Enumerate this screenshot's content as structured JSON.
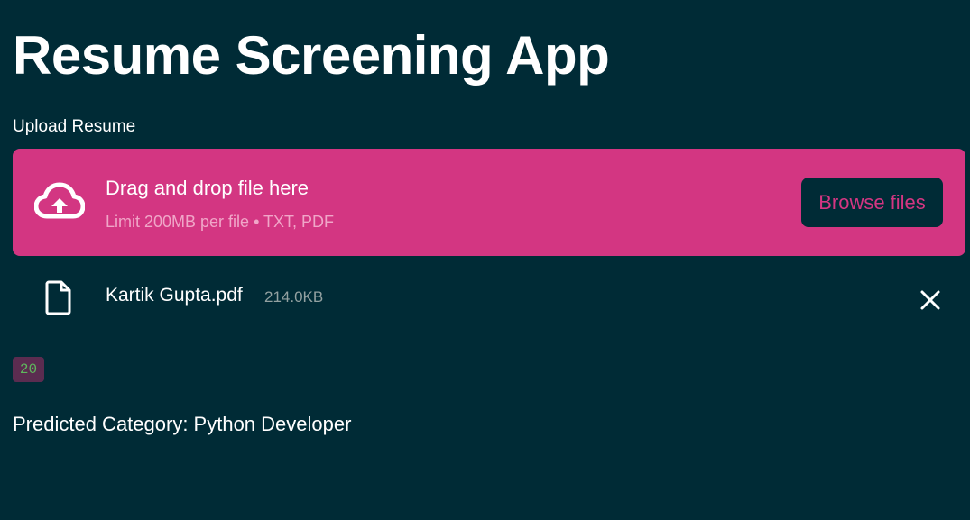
{
  "app": {
    "title": "Resume Screening App"
  },
  "uploader": {
    "label": "Upload Resume",
    "drop_title": "Drag and drop file here",
    "limit_text": "Limit 200MB per file • TXT, PDF",
    "browse_label": "Browse files",
    "upload_icon": "cloud-upload-icon"
  },
  "uploaded_file": {
    "name": "Kartik Gupta.pdf",
    "size": "214.0KB",
    "file_icon": "file-icon",
    "remove_icon": "close-icon"
  },
  "output": {
    "code_value": "20",
    "prediction": "Predicted Category: Python Developer"
  },
  "colors": {
    "background": "#002b36",
    "accent": "#d33682",
    "text": "#ffffff",
    "muted": "#93a1a1",
    "code_background": "#5b2c50",
    "code_text": "#5eb85d"
  }
}
